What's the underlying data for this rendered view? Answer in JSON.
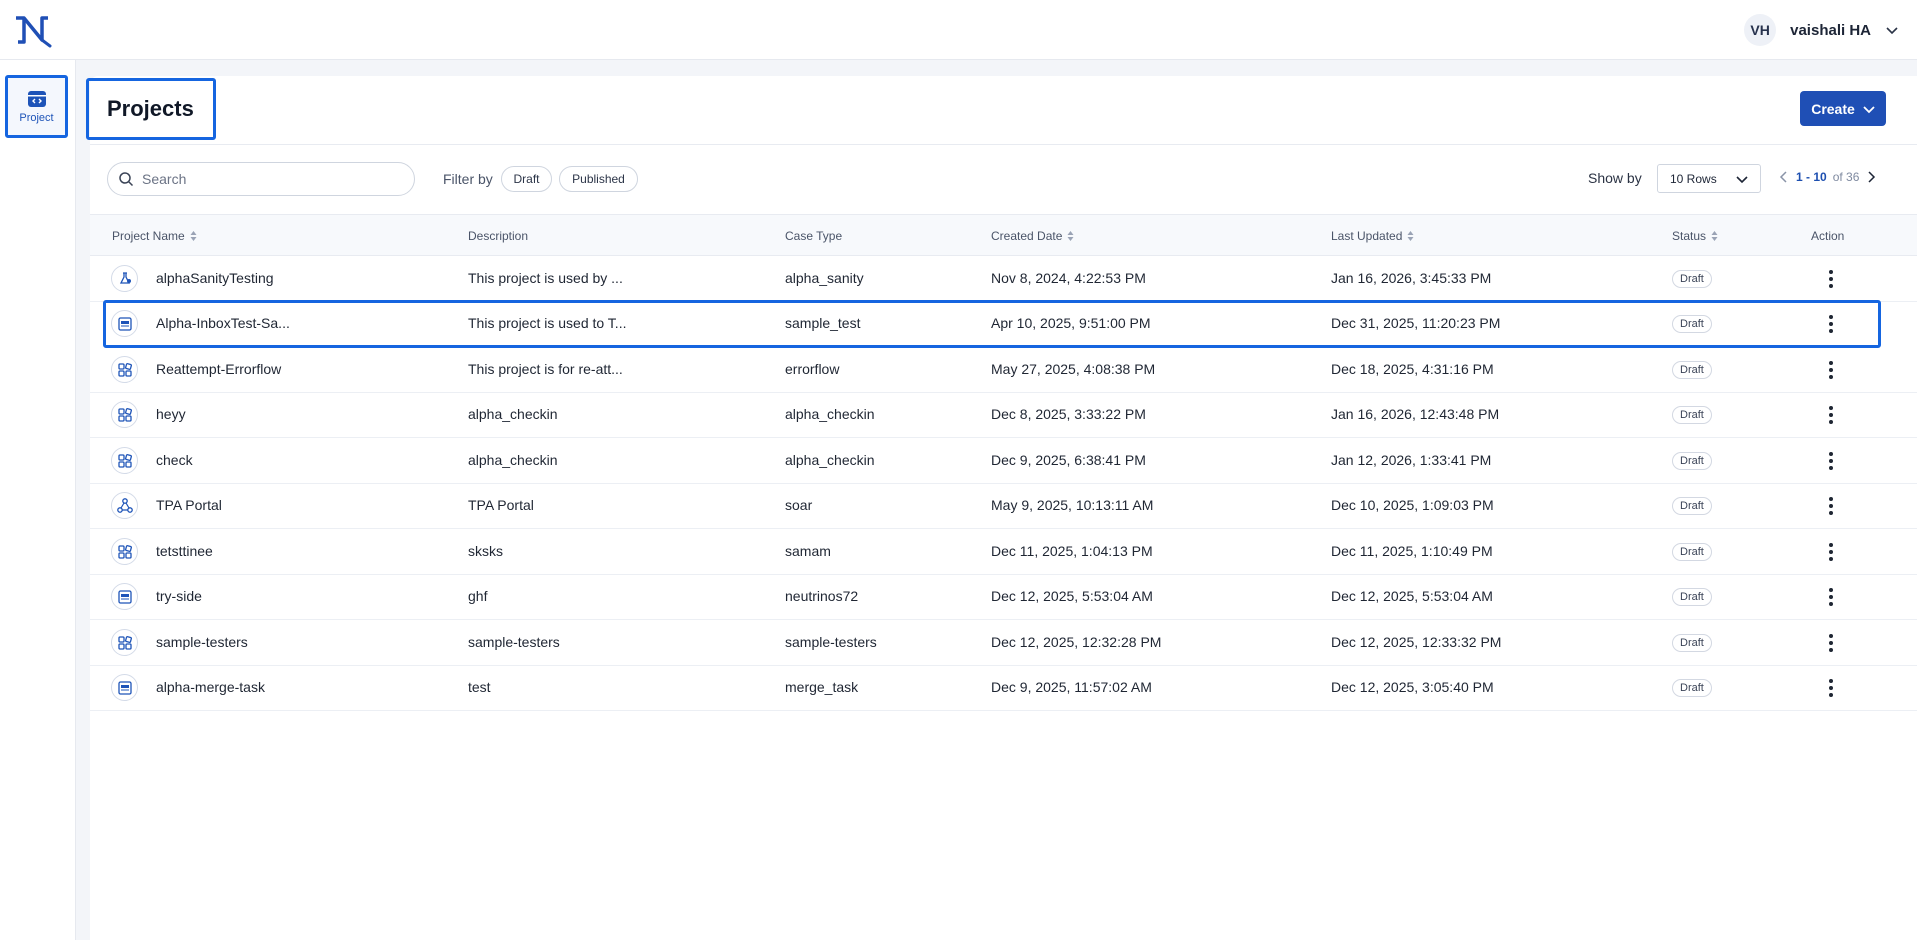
{
  "header": {
    "user_initials": "VH",
    "user_name": "vaishali HA"
  },
  "sidebar": {
    "items": [
      {
        "label": "Project",
        "icon": "project-icon"
      }
    ]
  },
  "page": {
    "title": "Projects",
    "create_label": "Create"
  },
  "toolbar": {
    "search_placeholder": "Search",
    "filter_label": "Filter by",
    "filters": [
      "Draft",
      "Published"
    ],
    "show_by_label": "Show by",
    "rows_value": "10 Rows",
    "range": "1 - 10",
    "of_total": "of 36"
  },
  "table": {
    "columns": [
      "Project Name",
      "Description",
      "Case Type",
      "Created Date",
      "Last Updated",
      "Status",
      "Action"
    ],
    "rows": [
      {
        "icon": "flask-icon",
        "name": "alphaSanityTesting",
        "description": "This project is used by ...",
        "case_type": "alpha_sanity",
        "created": "Nov 8, 2024, 4:22:53 PM",
        "updated": "Jan 16, 2026, 3:45:33 PM",
        "status": "Draft"
      },
      {
        "icon": "sdk-icon",
        "name": "Alpha-InboxTest-Sa...",
        "description": "This project is used to T...",
        "case_type": "sample_test",
        "created": "Apr 10, 2025, 9:51:00 PM",
        "updated": "Dec 31, 2025, 11:20:23 PM",
        "status": "Draft"
      },
      {
        "icon": "grid-icon",
        "name": "Reattempt-Errorflow",
        "description": "This project is for re-att...",
        "case_type": "errorflow",
        "created": "May 27, 2025, 4:08:38 PM",
        "updated": "Dec 18, 2025, 4:31:16 PM",
        "status": "Draft"
      },
      {
        "icon": "grid-icon",
        "name": "heyy",
        "description": "alpha_checkin",
        "case_type": "alpha_checkin",
        "created": "Dec 8, 2025, 3:33:22 PM",
        "updated": "Jan 16, 2026, 12:43:48 PM",
        "status": "Draft"
      },
      {
        "icon": "grid-icon",
        "name": "check",
        "description": "alpha_checkin",
        "case_type": "alpha_checkin",
        "created": "Dec 9, 2025, 6:38:41 PM",
        "updated": "Jan 12, 2026, 1:33:41 PM",
        "status": "Draft"
      },
      {
        "icon": "hub-icon",
        "name": "TPA Portal",
        "description": "TPA Portal",
        "case_type": "soar",
        "created": "May 9, 2025, 10:13:11 AM",
        "updated": "Dec 10, 2025, 1:09:03 PM",
        "status": "Draft"
      },
      {
        "icon": "grid-icon",
        "name": "tetsttinee",
        "description": "sksks",
        "case_type": "samam",
        "created": "Dec 11, 2025, 1:04:13 PM",
        "updated": "Dec 11, 2025, 1:10:49 PM",
        "status": "Draft"
      },
      {
        "icon": "sdk-icon",
        "name": "try-side",
        "description": "ghf",
        "case_type": "neutrinos72",
        "created": "Dec 12, 2025, 5:53:04 AM",
        "updated": "Dec 12, 2025, 5:53:04 AM",
        "status": "Draft"
      },
      {
        "icon": "grid-icon",
        "name": "sample-testers",
        "description": "sample-testers",
        "case_type": "sample-testers",
        "created": "Dec 12, 2025, 12:32:28 PM",
        "updated": "Dec 12, 2025, 12:33:32 PM",
        "status": "Draft"
      },
      {
        "icon": "sdk-icon",
        "name": "alpha-merge-task",
        "description": "test",
        "case_type": "merge_task",
        "created": "Dec 9, 2025, 11:57:02 AM",
        "updated": "Dec 12, 2025, 3:05:40 PM",
        "status": "Draft"
      }
    ]
  },
  "colors": {
    "accent": "#1f4fb5",
    "highlight": "#1565e0",
    "background": "#f3f5f9"
  }
}
